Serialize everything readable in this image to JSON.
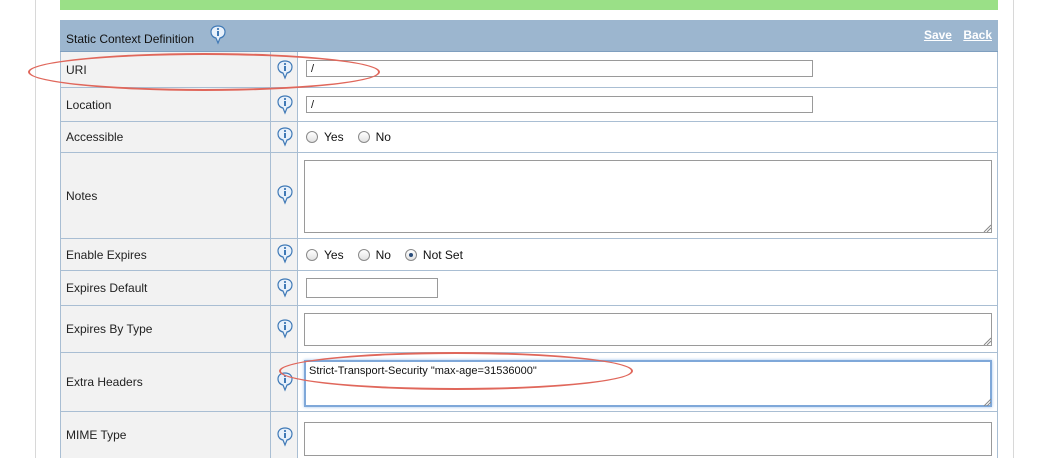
{
  "panel": {
    "title": "Static Context Definition",
    "save_label": "Save",
    "back_label": "Back"
  },
  "rows": {
    "uri": {
      "label": "URI",
      "value": "/"
    },
    "location": {
      "label": "Location",
      "value": "/"
    },
    "accessible": {
      "label": "Accessible",
      "options": [
        "Yes",
        "No"
      ],
      "selected": null
    },
    "notes": {
      "label": "Notes",
      "value": ""
    },
    "enable_expires": {
      "label": "Enable Expires",
      "options": [
        "Yes",
        "No",
        "Not Set"
      ],
      "selected": "Not Set"
    },
    "expires_default": {
      "label": "Expires Default",
      "value": ""
    },
    "expires_by_type": {
      "label": "Expires By Type",
      "value": ""
    },
    "extra_headers": {
      "label": "Extra Headers",
      "value": "Strict-Transport-Security \"max-age=31536000\""
    },
    "mime_type": {
      "label": "MIME Type",
      "value": ""
    }
  },
  "icons": {
    "help": "info-speech-bubble-icon"
  },
  "colors": {
    "header_bg": "#9cb6cf",
    "top_bar": "#9ae087",
    "label_bg": "#f2f2f2",
    "annotation": "#e0675b",
    "focus_border": "#7fa8d9"
  }
}
